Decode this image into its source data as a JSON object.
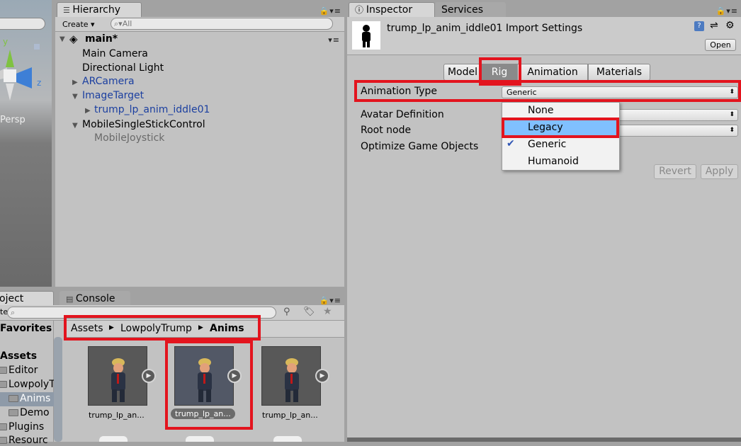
{
  "scene": {
    "axis_y": "y",
    "axis_z": "z",
    "view_mode": "Persp"
  },
  "hierarchy": {
    "tab_label": "Hierarchy",
    "create_label": "Create ▾",
    "search_placeholder": "All",
    "scene_name": "main*",
    "items": [
      {
        "label": "Main Camera"
      },
      {
        "label": "Directional Light"
      },
      {
        "label": "ARCamera"
      },
      {
        "label": "ImageTarget"
      },
      {
        "label": "trump_lp_anim_iddle01"
      },
      {
        "label": "MobileSingleStickControl"
      },
      {
        "label": "MobileJoystick"
      }
    ]
  },
  "inspector": {
    "tab_label": "Inspector",
    "services_label": "Services",
    "title": "trump_lp_anim_iddle01 Import Settings",
    "open_label": "Open",
    "tabs": [
      "Model",
      "Rig",
      "Animation",
      "Materials"
    ],
    "selected_tab": "Rig",
    "fields": {
      "animation_type_label": "Animation Type",
      "animation_type_value": "Generic",
      "avatar_definition_label": "Avatar Definition",
      "root_node_label": "Root node",
      "optimize_label": "Optimize Game Objects"
    },
    "dropdown_options": [
      {
        "label": "None",
        "checked": false
      },
      {
        "label": "Legacy",
        "checked": false
      },
      {
        "label": "Generic",
        "checked": true
      },
      {
        "label": "Humanoid",
        "checked": false
      }
    ],
    "highlighted_option": "Legacy",
    "revert_label": "Revert",
    "apply_label": "Apply"
  },
  "project": {
    "tab_label": "oject",
    "console_label": "Console",
    "create_fragment": "te ▾",
    "favorites_label": "Favorites",
    "assets_label": "Assets",
    "folders": [
      "Editor",
      "LowpolyT",
      "Anims",
      "Demo",
      "Plugins",
      "Resourc"
    ],
    "breadcrumb": [
      "Assets",
      "LowpolyTrump",
      "Anims"
    ],
    "assets": [
      {
        "caption": "trump_lp_an..."
      },
      {
        "caption": "trump_lp_an..."
      },
      {
        "caption": "trump_lp_an..."
      }
    ]
  },
  "colors": {
    "highlight": "#e3141e",
    "selection": "#80c0ff"
  }
}
